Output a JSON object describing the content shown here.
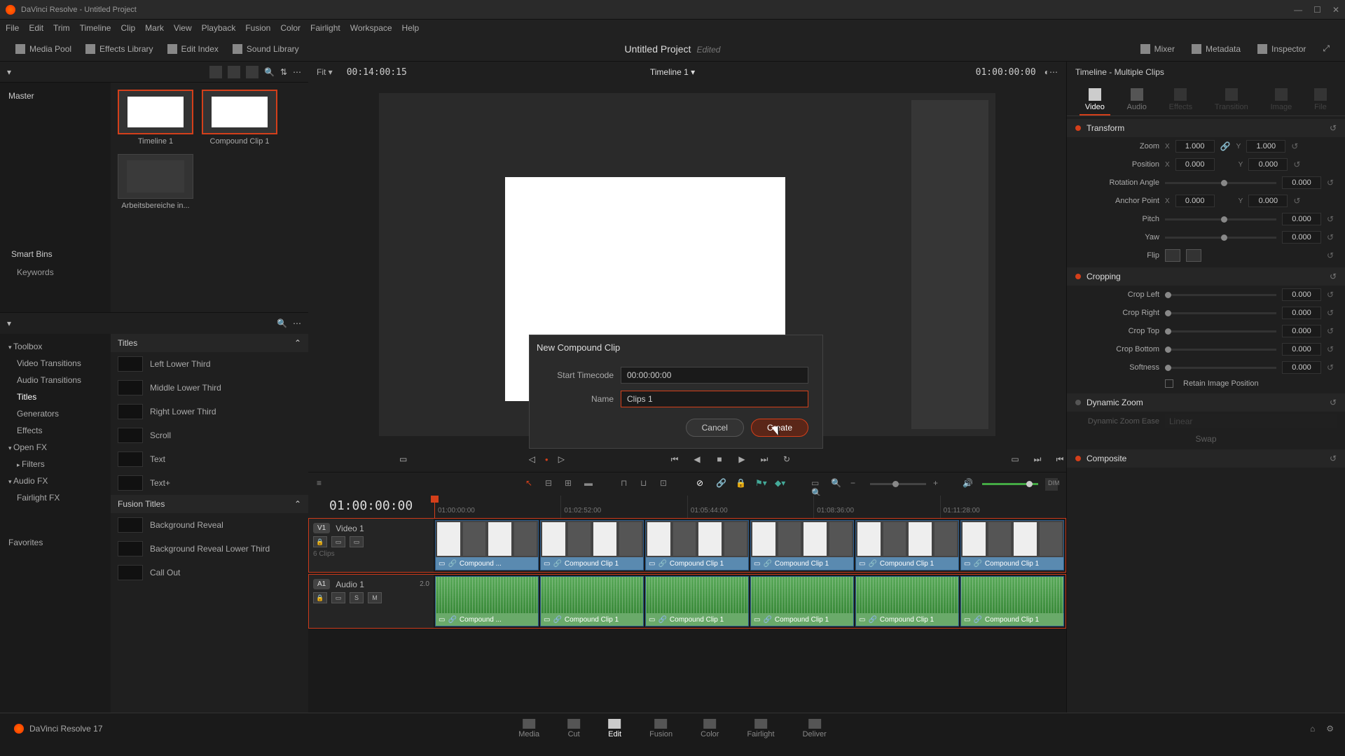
{
  "titlebar": {
    "title": "DaVinci Resolve - Untitled Project"
  },
  "menu": [
    "File",
    "Edit",
    "Trim",
    "Timeline",
    "Clip",
    "Mark",
    "View",
    "Playback",
    "Fusion",
    "Color",
    "Fairlight",
    "Workspace",
    "Help"
  ],
  "toolbar": {
    "media_pool": "Media Pool",
    "effects_library": "Effects Library",
    "edit_index": "Edit Index",
    "sound_library": "Sound Library",
    "project": "Untitled Project",
    "status": "Edited",
    "mixer": "Mixer",
    "metadata": "Metadata",
    "inspector": "Inspector"
  },
  "media": {
    "root": "Master",
    "thumbs": [
      {
        "label": "Timeline 1",
        "selected": true
      },
      {
        "label": "Compound Clip 1",
        "selected": true
      },
      {
        "label": "Arbeitsbereiche in...",
        "selected": false
      }
    ],
    "smart_bins": "Smart Bins",
    "keywords": "Keywords"
  },
  "fx_tree": {
    "toolbox": "Toolbox",
    "video_transitions": "Video Transitions",
    "audio_transitions": "Audio Transitions",
    "titles": "Titles",
    "generators": "Generators",
    "effects": "Effects",
    "open_fx": "Open FX",
    "filters": "Filters",
    "audio_fx": "Audio FX",
    "fairlight_fx": "Fairlight FX",
    "favorites": "Favorites"
  },
  "fx_list": {
    "titles_header": "Titles",
    "titles": [
      "Left Lower Third",
      "Middle Lower Third",
      "Right Lower Third",
      "Scroll",
      "Text",
      "Text+"
    ],
    "fusion_header": "Fusion Titles",
    "fusion": [
      "Background Reveal",
      "Background Reveal Lower Third",
      "Call Out"
    ]
  },
  "viewer": {
    "fit": "Fit",
    "tc_left": "00:14:00:15",
    "timeline_name": "Timeline 1",
    "tc_right": "01:00:00:00",
    "big_tc": "01:00:00:00",
    "ticks": [
      "01:00:00:00",
      "01:02:52:00",
      "01:05:44:00",
      "01:08:36:00",
      "01:11:28:00"
    ]
  },
  "dialog": {
    "title": "New Compound Clip",
    "timecode_label": "Start Timecode",
    "timecode_value": "00:00:00:00",
    "name_label": "Name",
    "name_value": "Clips 1",
    "cancel": "Cancel",
    "create": "Create"
  },
  "tracks": {
    "v1_badge": "V1",
    "v1_name": "Video 1",
    "v1_count": "6 Clips",
    "a1_badge": "A1",
    "a1_name": "Audio 1",
    "a1_ch": "2.0",
    "clip_label_short": "Compound ...",
    "clip_label_full": "Compound Clip 1"
  },
  "inspector": {
    "header": "Timeline - Multiple Clips",
    "tabs": {
      "video": "Video",
      "audio": "Audio",
      "effects": "Effects",
      "transition": "Transition",
      "image": "Image",
      "file": "File"
    },
    "transform": {
      "title": "Transform",
      "zoom": "Zoom",
      "zoom_x": "1.000",
      "zoom_y": "1.000",
      "position": "Position",
      "pos_x": "0.000",
      "pos_y": "0.000",
      "rotation": "Rotation Angle",
      "rot_v": "0.000",
      "anchor": "Anchor Point",
      "anc_x": "0.000",
      "anc_y": "0.000",
      "pitch": "Pitch",
      "pitch_v": "0.000",
      "yaw": "Yaw",
      "yaw_v": "0.000",
      "flip": "Flip"
    },
    "cropping": {
      "title": "Cropping",
      "left": "Crop Left",
      "left_v": "0.000",
      "right": "Crop Right",
      "right_v": "0.000",
      "top": "Crop Top",
      "top_v": "0.000",
      "bottom": "Crop Bottom",
      "bottom_v": "0.000",
      "softness": "Softness",
      "soft_v": "0.000",
      "retain": "Retain Image Position"
    },
    "dynamic_zoom": {
      "title": "Dynamic Zoom",
      "ease": "Dynamic Zoom Ease",
      "ease_v": "Linear",
      "swap": "Swap"
    },
    "composite": {
      "title": "Composite"
    }
  },
  "bottombar": {
    "brand": "DaVinci Resolve 17",
    "pages": [
      "Media",
      "Cut",
      "Edit",
      "Fusion",
      "Color",
      "Fairlight",
      "Deliver"
    ]
  }
}
